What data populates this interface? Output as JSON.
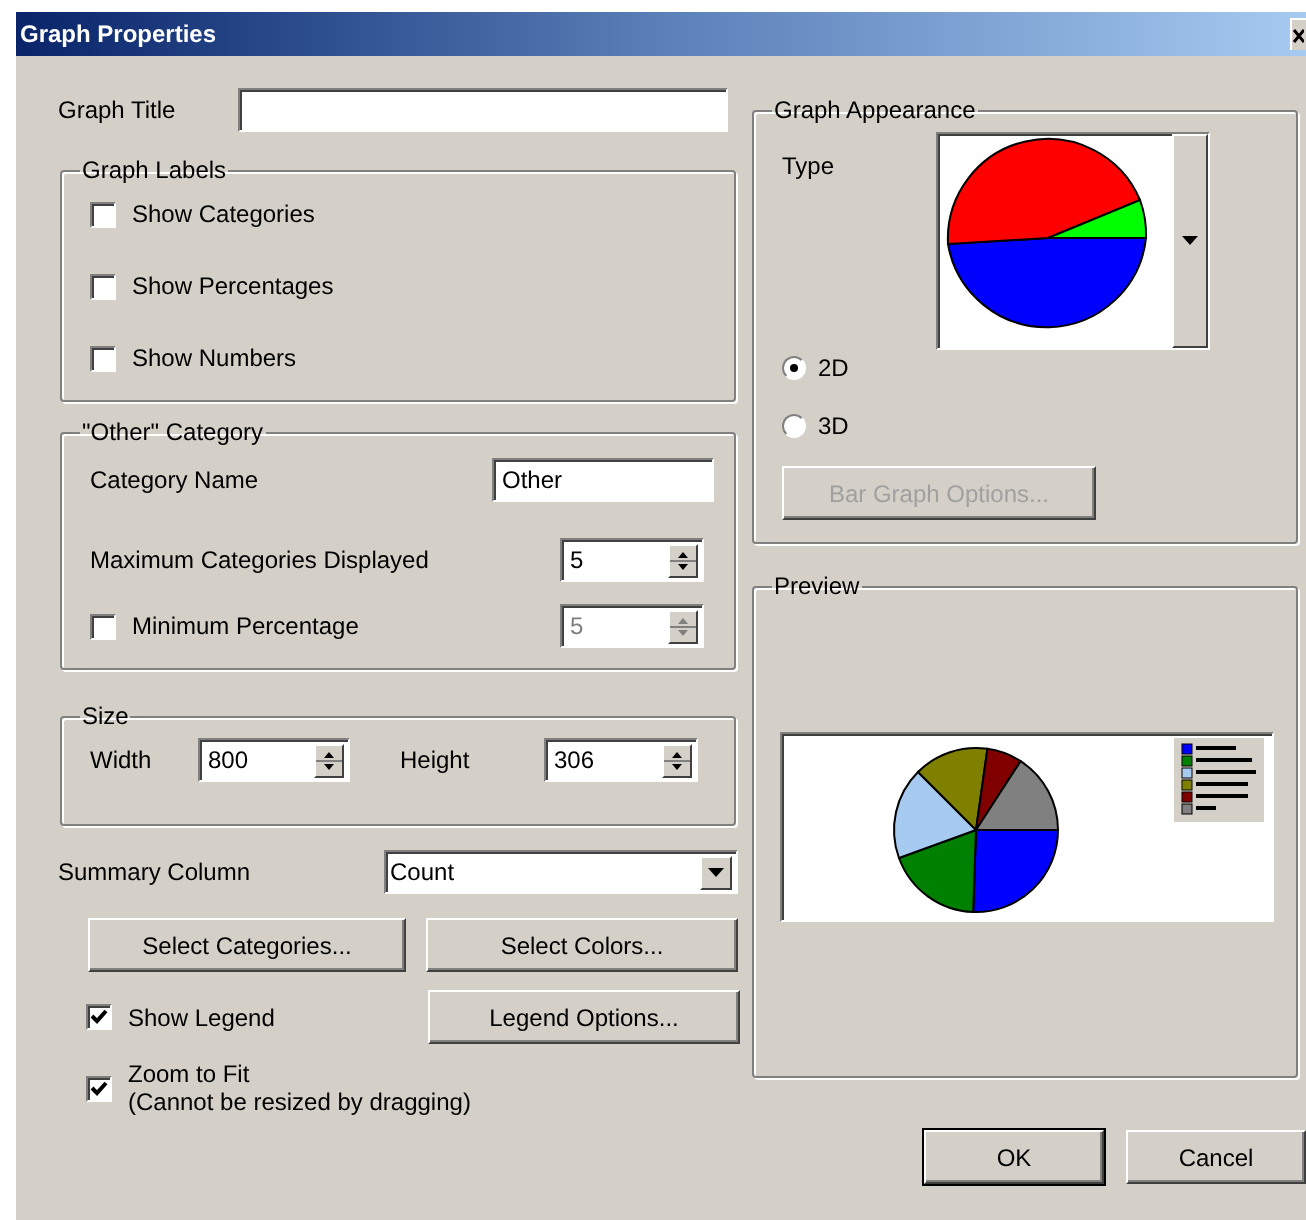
{
  "window": {
    "title": "Graph Properties"
  },
  "graph_title": {
    "label": "Graph Title"
  },
  "graph_labels": {
    "title": "Graph Labels",
    "options": [
      {
        "label": "Show Categories",
        "checked": false
      },
      {
        "label": "Show Percentages",
        "checked": false
      },
      {
        "label": "Show Numbers",
        "checked": false
      }
    ]
  },
  "other_category": {
    "title": "\"Other\" Category",
    "category_name": {
      "label": "Category Name",
      "value": "Other"
    },
    "max_categories": {
      "label": "Maximum Categories Displayed",
      "value": "5"
    },
    "minimum_percentage": {
      "label": "Minimum Percentage",
      "checked": false,
      "value": "5",
      "disabled": true
    }
  },
  "size": {
    "title": "Size",
    "width": {
      "label": "Width",
      "value": "800"
    },
    "height": {
      "label": "Height",
      "value": "306"
    }
  },
  "summary_column": {
    "label": "Summary Column",
    "value": "Count"
  },
  "buttons_left": [
    {
      "label": "Select Categories...",
      "disabled": false
    },
    {
      "label": "Select Colors...",
      "disabled": false
    },
    {
      "label": "Legend Options...",
      "disabled": false
    }
  ],
  "show_legend": {
    "label": "Show Legend",
    "checked": true
  },
  "zoom_to_fit": {
    "label": "Zoom to Fit",
    "note": "(Cannot be resized by dragging)",
    "checked": true
  },
  "graph_appearance": {
    "title": "Graph Appearance",
    "type_label": "Type",
    "modes": [
      {
        "label": "2D",
        "selected": true
      },
      {
        "label": "3D",
        "selected": false
      }
    ],
    "bar_graph_options": {
      "label": "Bar Graph Options...",
      "disabled": true
    }
  },
  "preview": {
    "title": "Preview"
  },
  "dialog_buttons": [
    {
      "label": "OK",
      "default": true
    },
    {
      "label": "Cancel",
      "default": false
    }
  ]
}
